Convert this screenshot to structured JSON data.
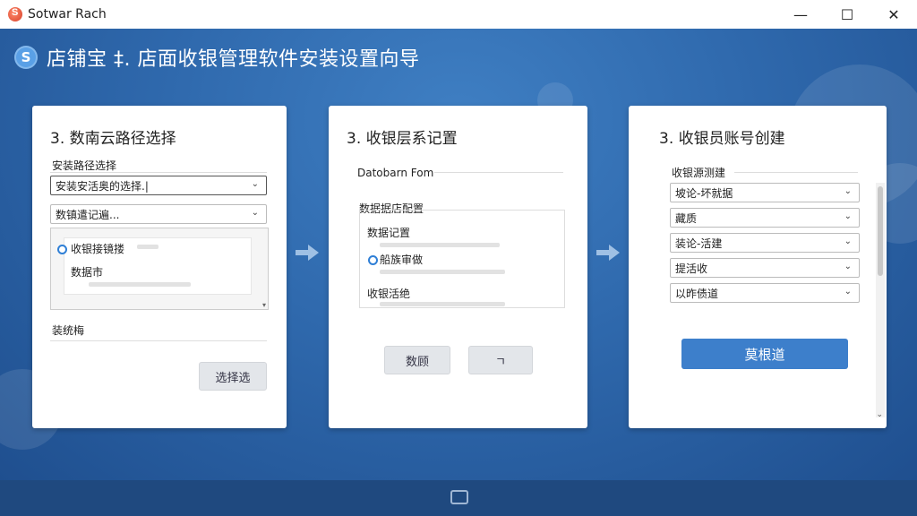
{
  "window": {
    "app_title": "Sotwar Rach",
    "minimize": "—",
    "maximize": "☐",
    "close": "✕"
  },
  "header": {
    "icon_letter": "S",
    "title": "店铺宝 ‡. 店面收银管理软件安装设置向导"
  },
  "card1": {
    "title": "3. 数南云路径选择",
    "path_label": "安装路径选择",
    "path_value": "安装安活奥的选择.|",
    "db_value": "数镇遣记遍...",
    "list_item_1": "收银接镜搂",
    "list_item_2": "数据市",
    "section_label": "装统梅",
    "button": "选择选"
  },
  "card2": {
    "title": "3. 收银层系记置",
    "field": "Datobarn Fom",
    "section_label": "数据据店配置",
    "row_1": "数据记置",
    "row_2": "船族审做",
    "row_3": "收银活绝",
    "btn_left": "数顾",
    "btn_right": "ㄱ"
  },
  "card3": {
    "title": "3. 收银员账号创建",
    "section_label": "收银源测建",
    "selects": [
      "坡论-坏就据",
      "藏质",
      "装论-活建",
      "提活收",
      "以昨债道"
    ],
    "button": "莫根道"
  },
  "icons": [
    "app-logo-icon",
    "header-logo-icon",
    "chevron-down-icon",
    "arrow-right-icon",
    "bottom-tray-icon"
  ],
  "colors": {
    "background_blue": "#2f69ad",
    "primary_button": "#3d7fcb",
    "radio_blue": "#2f7fd6"
  }
}
